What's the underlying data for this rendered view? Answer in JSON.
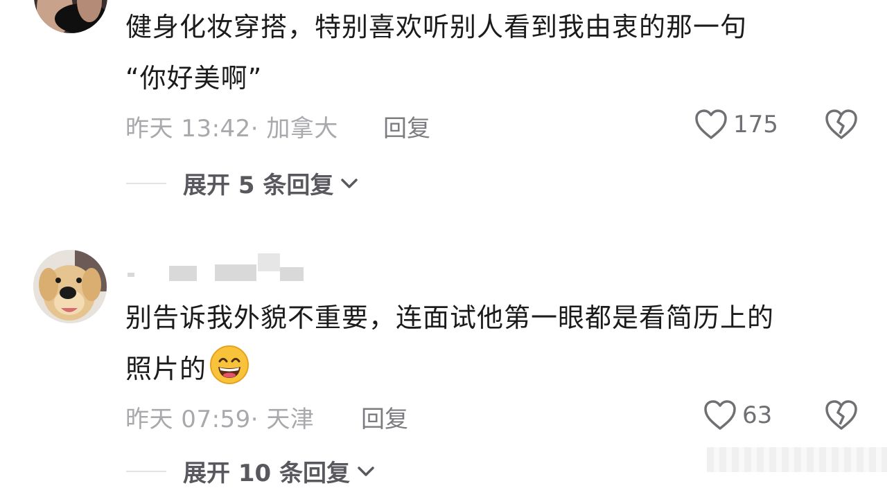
{
  "comments": [
    {
      "lines": [
        "健身化妆穿搭，特别喜欢听别人看到我由衷的那一句",
        "“你好美啊”"
      ],
      "meta": "昨天 13:42· 加拿大",
      "reply_label": "回复",
      "likes": "175",
      "expand_label": "展开 5 条回复"
    },
    {
      "username": "",
      "lines": [
        "别告诉我外貌不重要，连面试他第一眼都是看简历上的",
        "照片的"
      ],
      "meta": "昨天 07:59· 天津",
      "reply_label": "回复",
      "likes": "63",
      "expand_label": "展开 10 条回复"
    }
  ],
  "icons": {
    "like": "heart-outline-icon",
    "dislike": "broken-heart-icon",
    "expand": "chevron-down-icon",
    "emoji": "grinning-face-emoji"
  },
  "colors": {
    "text": "#1b1b1b",
    "meta": "#a8a8ad",
    "action": "#6f6f74"
  }
}
